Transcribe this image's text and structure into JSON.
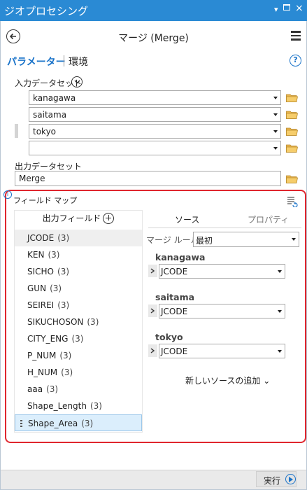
{
  "window": {
    "title": "ジオプロセシング",
    "pin_glyph": "▾",
    "restore_glyph": "▫",
    "close_glyph": "×"
  },
  "tool": {
    "title": "マージ (Merge)"
  },
  "tabs": {
    "parameters": "パラメーター",
    "environments": "環境"
  },
  "help": {
    "glyph": "?"
  },
  "input_datasets": {
    "label": "入力データセット",
    "items": [
      "kanagawa",
      "saitama",
      "tokyo",
      ""
    ]
  },
  "output_dataset": {
    "label": "出力データセット",
    "value": "Merge"
  },
  "field_map": {
    "label": "フィールド マップ",
    "info_glyph": "i",
    "output_fields_header": "出力フィールド",
    "fields": [
      {
        "name": "JCODE",
        "count": "(3)"
      },
      {
        "name": "KEN",
        "count": "(3)"
      },
      {
        "name": "SICHO",
        "count": "(3)"
      },
      {
        "name": "GUN",
        "count": "(3)"
      },
      {
        "name": "SEIREI",
        "count": "(3)"
      },
      {
        "name": "SIKUCHOSON",
        "count": "(3)"
      },
      {
        "name": "CITY_ENG",
        "count": "(3)"
      },
      {
        "name": "P_NUM",
        "count": "(3)"
      },
      {
        "name": "H_NUM",
        "count": "(3)"
      },
      {
        "name": "aaa",
        "count": "(3)"
      },
      {
        "name": "Shape_Length",
        "count": "(3)"
      },
      {
        "name": "Shape_Area",
        "count": "(3)"
      }
    ],
    "tabs": {
      "source": "ソース",
      "properties": "プロパティ"
    },
    "merge_rule": {
      "label": "マージ ルール",
      "value": "最初"
    },
    "sources": [
      {
        "name": "kanagawa",
        "field": "JCODE"
      },
      {
        "name": "saitama",
        "field": "JCODE"
      },
      {
        "name": "tokyo",
        "field": "JCODE"
      }
    ],
    "add_source": "新しいソースの追加",
    "add_source_chevron": "⌄"
  },
  "footer": {
    "run_label": "実行"
  },
  "colors": {
    "titlebar": "#2a8ad4",
    "accent": "#1a73c9",
    "highlight_border": "#e0262e",
    "selected_row": "#dbeefc"
  }
}
